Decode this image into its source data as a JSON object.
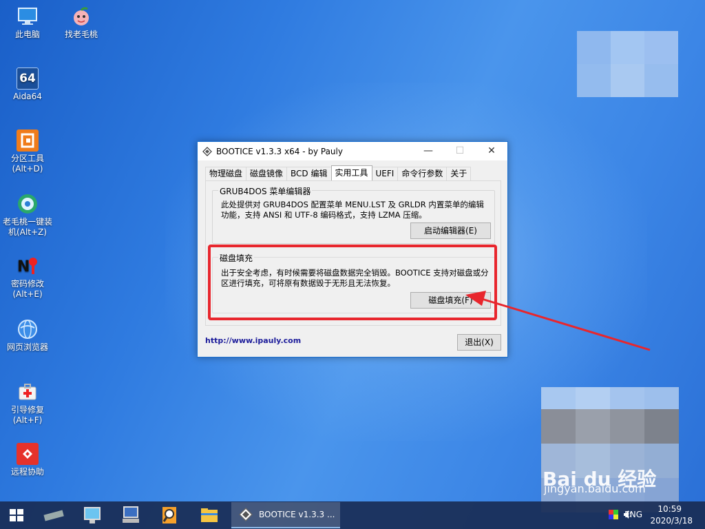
{
  "desktop": {
    "icons": [
      {
        "label": "此电脑",
        "icon": "computer-icon"
      },
      {
        "label": "找老毛桃",
        "icon": "peach-icon"
      },
      {
        "label": "Aida64",
        "icon": "aida64-icon"
      },
      {
        "label": "分区工具\n(Alt+D)",
        "icon": "partition-tool-icon"
      },
      {
        "label": "老毛桃一键装\n机(Alt+Z)",
        "icon": "one-click-install-icon"
      },
      {
        "label": "密码修改\n(Alt+E)",
        "icon": "password-modify-icon"
      },
      {
        "label": "网页浏览器",
        "icon": "web-browser-icon"
      },
      {
        "label": "引导修复\n(Alt+F)",
        "icon": "boot-repair-icon"
      },
      {
        "label": "远程协助",
        "icon": "remote-assist-icon"
      }
    ],
    "aida_badge": "64"
  },
  "dialog": {
    "title": "BOOTICE v1.3.3 x64 - by Pauly",
    "tabs": [
      {
        "label": "物理磁盘"
      },
      {
        "label": "磁盘镜像"
      },
      {
        "label": "BCD 编辑"
      },
      {
        "label": "实用工具"
      },
      {
        "label": "UEFI"
      },
      {
        "label": "命令行参数"
      },
      {
        "label": "关于"
      }
    ],
    "active_tab": "实用工具",
    "grub_group": {
      "title": "GRUB4DOS 菜单编辑器",
      "text": "此处提供对 GRUB4DOS 配置菜单 MENU.LST 及 GRLDR 内置菜单的编辑功能，支持 ANSI 和 UTF-8 编码格式，支持 LZMA 压缩。",
      "button": "启动编辑器(E)"
    },
    "fill_group": {
      "title": "磁盘填充",
      "text": "出于安全考虑，有时候需要将磁盘数据完全销毁。BOOTICE 支持对磁盘或分区进行填充，可将原有数据毁于无形且无法恢复。",
      "button": "磁盘填充(F)"
    },
    "link": "http://www.ipauly.com",
    "exit_button": "退出(X)"
  },
  "annotation": {
    "color": "#e8262d"
  },
  "taskbar": {
    "active_window_label": "BOOTICE v1.3.3 ...",
    "language": "ENG",
    "time": "10:59",
    "date": "2020/3/18"
  },
  "watermark": {
    "brand": "Bai du 经验",
    "sub": "jingyan.baidu.com"
  }
}
